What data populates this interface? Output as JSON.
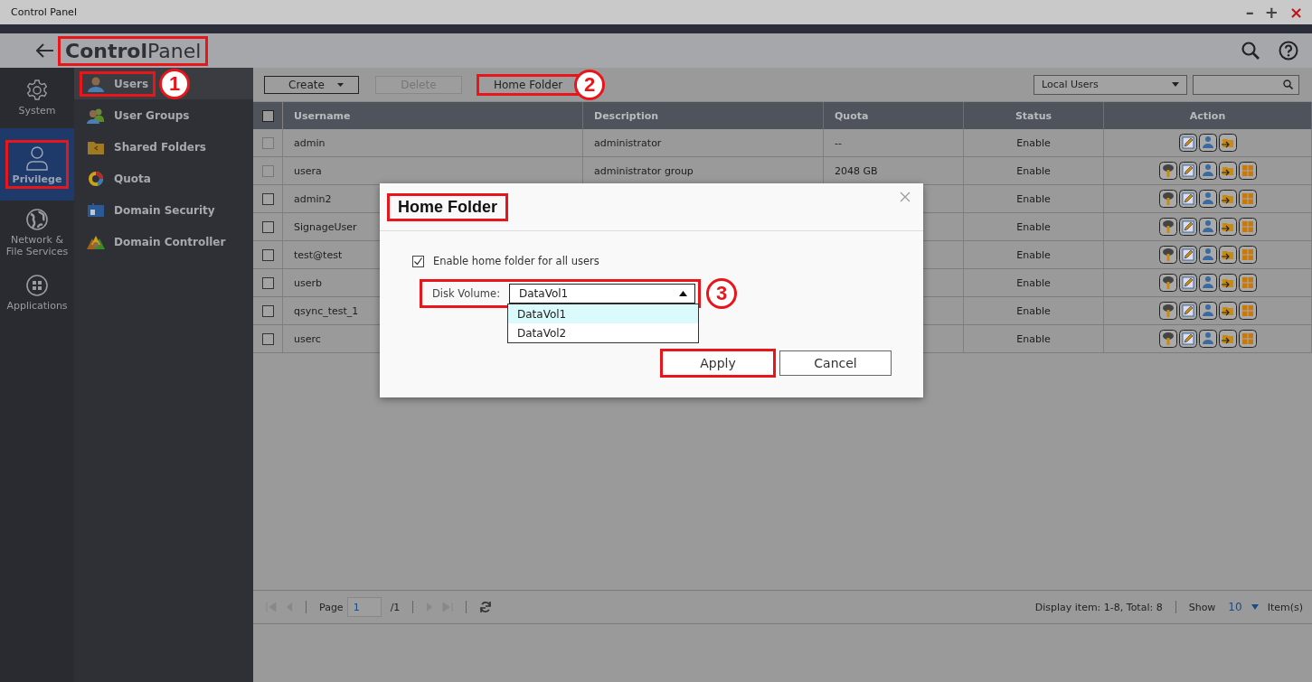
{
  "window": {
    "title": "Control Panel",
    "controls": [
      "–",
      "+",
      "×"
    ]
  },
  "header": {
    "title": "**Control**Panel",
    "highlighted": true
  },
  "nav": [
    {
      "label": "System",
      "kind": "gear",
      "selected": false,
      "highlighted": false
    },
    {
      "label": "Privilege",
      "kind": "person",
      "selected": true,
      "highlighted": true
    },
    {
      "label": "Network & File Services",
      "kind": "globe",
      "selected": false,
      "highlighted": false
    },
    {
      "label": "Applications",
      "kind": "apps",
      "selected": false,
      "highlighted": false
    }
  ],
  "subnav": [
    {
      "label": "Users",
      "kind": "user",
      "selected": true,
      "highlighted": true,
      "callout": "1"
    },
    {
      "label": "User Groups",
      "kind": "group",
      "selected": false,
      "highlighted": false
    },
    {
      "label": "Shared Folders",
      "kind": "folder",
      "selected": false,
      "highlighted": false
    },
    {
      "label": "Quota",
      "kind": "quota",
      "selected": false,
      "highlighted": false
    },
    {
      "label": "Domain Security",
      "kind": "security",
      "selected": false,
      "highlighted": false
    },
    {
      "label": "Domain Controller",
      "kind": "controller",
      "selected": false,
      "highlighted": false
    }
  ],
  "toolbar": {
    "buttons": [
      {
        "label": "Create",
        "caret": true,
        "disabled": false,
        "highlighted": false
      },
      {
        "label": "Delete",
        "caret": false,
        "disabled": true,
        "highlighted": false
      },
      {
        "label": "Home Folder",
        "caret": false,
        "disabled": false,
        "highlighted": true,
        "callout": "2"
      }
    ],
    "filter": "Local Users"
  },
  "table": {
    "select_all_checked": false,
    "columns": [
      "Username",
      "Description",
      "Quota",
      "Status",
      "Action"
    ],
    "rows": [
      {
        "username": "admin",
        "description": "administrator",
        "quota": "--",
        "status": "Enable",
        "disabled": true,
        "actions": [
          {
            "kind": "edit"
          },
          {
            "kind": "group"
          },
          {
            "kind": "share"
          }
        ]
      },
      {
        "username": "usera",
        "description": "administrator group",
        "quota": "2048 GB",
        "status": "Enable",
        "disabled": true,
        "actions": [
          {
            "kind": "key"
          },
          {
            "kind": "edit"
          },
          {
            "kind": "group"
          },
          {
            "kind": "share"
          },
          {
            "kind": "apps"
          }
        ]
      },
      {
        "username": "admin2",
        "status": "Enable",
        "disabled": false,
        "actions": [
          {
            "kind": "key"
          },
          {
            "kind": "edit"
          },
          {
            "kind": "group"
          },
          {
            "kind": "share"
          },
          {
            "kind": "apps"
          }
        ]
      },
      {
        "username": "SignageUser",
        "status": "Enable",
        "disabled": false,
        "actions": [
          {
            "kind": "key"
          },
          {
            "kind": "edit"
          },
          {
            "kind": "group"
          },
          {
            "kind": "share"
          },
          {
            "kind": "apps"
          }
        ]
      },
      {
        "username": "test@test",
        "status": "Enable",
        "disabled": false,
        "actions": [
          {
            "kind": "key"
          },
          {
            "kind": "edit"
          },
          {
            "kind": "group"
          },
          {
            "kind": "share"
          },
          {
            "kind": "apps"
          }
        ]
      },
      {
        "username": "userb",
        "status": "Enable",
        "disabled": false,
        "actions": [
          {
            "kind": "key"
          },
          {
            "kind": "edit"
          },
          {
            "kind": "group"
          },
          {
            "kind": "share"
          },
          {
            "kind": "apps"
          }
        ]
      },
      {
        "username": "qsync_test_1",
        "status": "Enable",
        "disabled": false,
        "actions": [
          {
            "kind": "key"
          },
          {
            "kind": "edit"
          },
          {
            "kind": "group"
          },
          {
            "kind": "share"
          },
          {
            "kind": "apps"
          }
        ]
      },
      {
        "username": "userc",
        "status": "Enable",
        "disabled": false,
        "actions": [
          {
            "kind": "key"
          },
          {
            "kind": "edit"
          },
          {
            "kind": "group"
          },
          {
            "kind": "share"
          },
          {
            "kind": "apps"
          }
        ]
      }
    ]
  },
  "pager": {
    "page_label": "Page",
    "page": "1",
    "of": "/1",
    "summary": "Display item: 1-8, Total: 8",
    "show_label": "Show",
    "show": "10",
    "items_label": "Item(s)"
  },
  "dialog": {
    "title": "Home Folder",
    "title_highlighted": true,
    "checkbox": {
      "label": "Enable home folder for all users",
      "checked": true
    },
    "volume": {
      "label": "Disk Volume:",
      "value": "DataVol1",
      "highlighted": true,
      "callout": "3",
      "options": [
        {
          "label": "DataVol1",
          "selected": true
        },
        {
          "label": "DataVol2",
          "selected": false
        }
      ]
    },
    "buttons": [
      {
        "label": "Apply",
        "highlighted": true
      },
      {
        "label": "Cancel",
        "highlighted": false
      }
    ]
  }
}
